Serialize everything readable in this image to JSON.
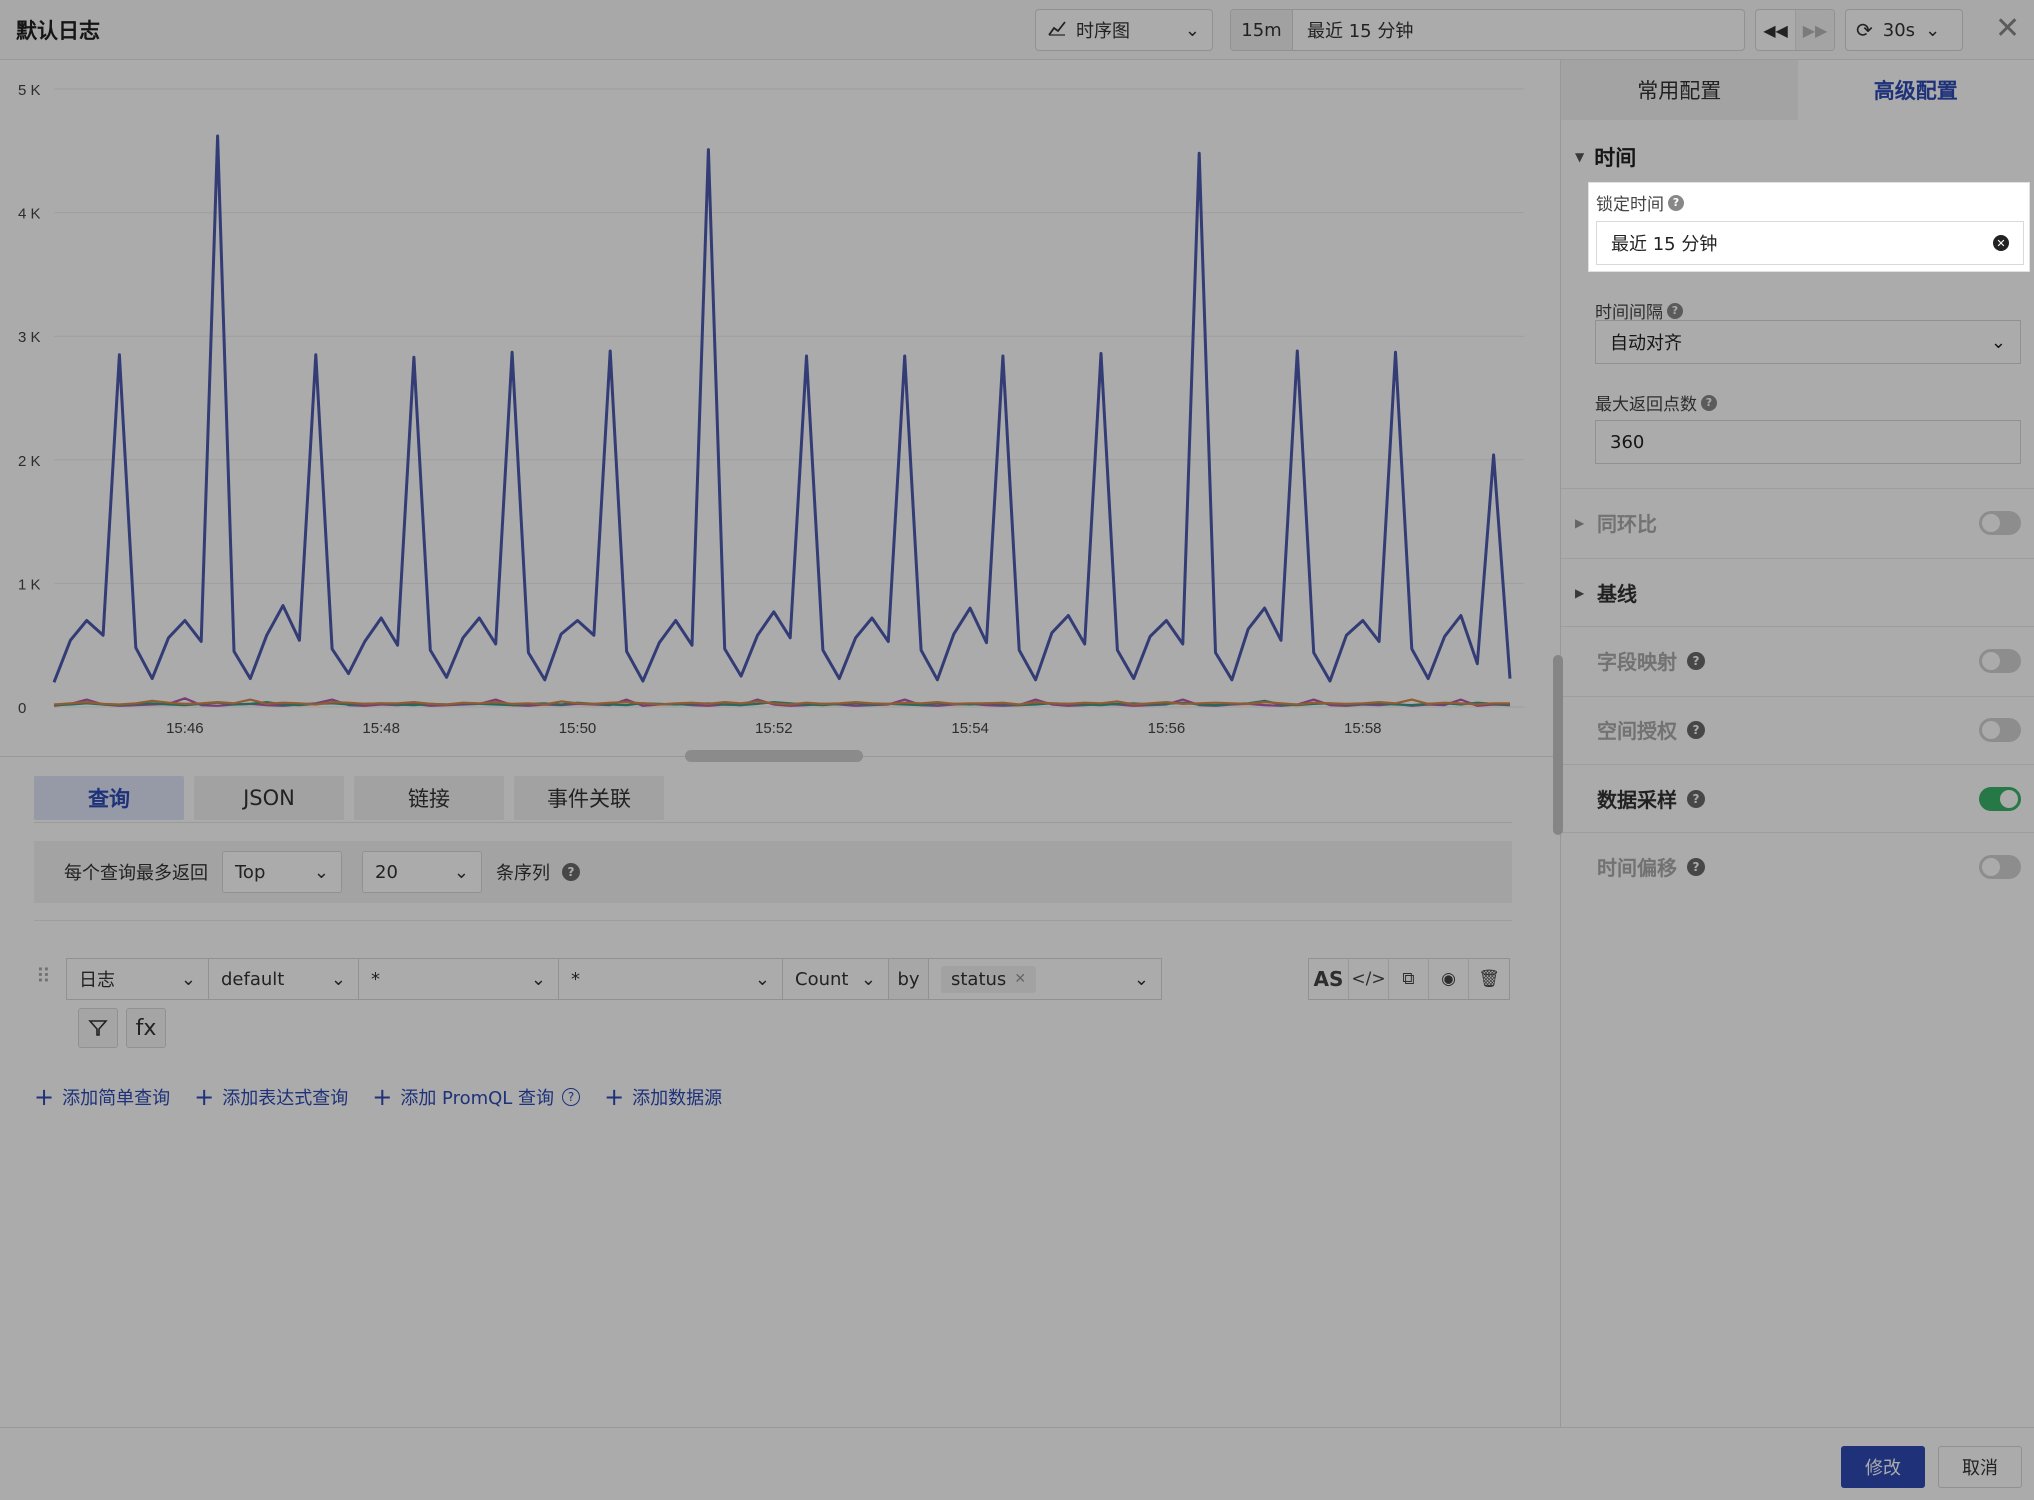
{
  "header": {
    "title": "默认日志",
    "viz_type": "时序图",
    "time_short": "15m",
    "time_long": "最近 15 分钟",
    "refresh_interval": "30s"
  },
  "chart_data": {
    "type": "line",
    "x": [
      "15:44:40",
      "15:44:50",
      "15:45:00",
      "15:45:10",
      "15:45:20",
      "15:45:30",
      "15:45:40",
      "15:45:50",
      "15:46:00",
      "15:46:10",
      "15:46:20",
      "15:46:30",
      "15:46:40",
      "15:46:50",
      "15:47:00",
      "15:47:10",
      "15:47:20",
      "15:47:30",
      "15:47:40",
      "15:47:50",
      "15:48:00",
      "15:48:10",
      "15:48:20",
      "15:48:30",
      "15:48:40",
      "15:48:50",
      "15:49:00",
      "15:49:10",
      "15:49:20",
      "15:49:30",
      "15:49:40",
      "15:49:50",
      "15:50:00",
      "15:50:10",
      "15:50:20",
      "15:50:30",
      "15:50:40",
      "15:50:50",
      "15:51:00",
      "15:51:10",
      "15:51:20",
      "15:51:30",
      "15:51:40",
      "15:51:50",
      "15:52:00",
      "15:52:10",
      "15:52:20",
      "15:52:30",
      "15:52:40",
      "15:52:50",
      "15:53:00",
      "15:53:10",
      "15:53:20",
      "15:53:30",
      "15:53:40",
      "15:53:50",
      "15:54:00",
      "15:54:10",
      "15:54:20",
      "15:54:30",
      "15:54:40",
      "15:54:50",
      "15:55:00",
      "15:55:10",
      "15:55:20",
      "15:55:30",
      "15:55:40",
      "15:55:50",
      "15:56:00",
      "15:56:10",
      "15:56:20",
      "15:56:30",
      "15:56:40",
      "15:56:50",
      "15:57:00",
      "15:57:10",
      "15:57:20",
      "15:57:30",
      "15:57:40",
      "15:57:50",
      "15:58:00",
      "15:58:10",
      "15:58:20",
      "15:58:30",
      "15:58:40",
      "15:58:50",
      "15:59:00",
      "15:59:10",
      "15:59:20",
      "15:59:30"
    ],
    "series": [
      {
        "color": "#4c5aaf",
        "values": [
          200,
          540,
          700,
          580,
          2850,
          480,
          230,
          560,
          700,
          530,
          4620,
          450,
          230,
          580,
          820,
          540,
          2850,
          470,
          270,
          530,
          720,
          500,
          2830,
          460,
          240,
          560,
          720,
          510,
          2870,
          440,
          220,
          590,
          700,
          580,
          2880,
          450,
          210,
          520,
          700,
          500,
          4510,
          470,
          250,
          580,
          770,
          560,
          2840,
          460,
          230,
          560,
          720,
          530,
          2840,
          460,
          220,
          590,
          800,
          520,
          2840,
          460,
          220,
          600,
          740,
          510,
          2860,
          460,
          230,
          570,
          700,
          510,
          4480,
          440,
          220,
          630,
          800,
          540,
          2880,
          440,
          210,
          580,
          700,
          530,
          2870,
          470,
          230,
          570,
          740,
          350,
          2040,
          230
        ]
      },
      {
        "color": "#d98a4a",
        "values": [
          20,
          30,
          40,
          25,
          20,
          30,
          50,
          35,
          25,
          30,
          40,
          30,
          60,
          25,
          35,
          30,
          20,
          40,
          35,
          25,
          30,
          30,
          40,
          25,
          20,
          35,
          30,
          40,
          25,
          30,
          20,
          45,
          30,
          25,
          35,
          40,
          30,
          20,
          30,
          35,
          25,
          40,
          30,
          45,
          30,
          20,
          35,
          25,
          30,
          40,
          30,
          25,
          35,
          30,
          40,
          25,
          30,
          30,
          35,
          20,
          40,
          30,
          25,
          35,
          30,
          45,
          20,
          30,
          40,
          25,
          30,
          35,
          30,
          25,
          40,
          30,
          20,
          35,
          30,
          25,
          30,
          40,
          30,
          60,
          25,
          35,
          30,
          20,
          30,
          30
        ]
      },
      {
        "color": "#3d9c8a",
        "values": [
          15,
          20,
          30,
          20,
          15,
          25,
          30,
          20,
          15,
          25,
          35,
          20,
          25,
          40,
          20,
          15,
          25,
          30,
          20,
          25,
          30,
          20,
          15,
          25,
          20,
          30,
          25,
          20,
          15,
          25,
          30,
          20,
          35,
          25,
          20,
          15,
          30,
          25,
          20,
          25,
          30,
          20,
          15,
          25,
          40,
          30,
          20,
          15,
          25,
          30,
          20,
          25,
          20,
          15,
          30,
          25,
          20,
          30,
          25,
          15,
          20,
          30,
          25,
          20,
          15,
          25,
          30,
          20,
          25,
          35,
          20,
          15,
          25,
          30,
          50,
          20,
          15,
          25,
          30,
          20,
          25,
          30,
          20,
          15,
          25,
          30,
          20,
          35,
          25,
          20
        ]
      },
      {
        "color": "#b55ab3",
        "values": [
          10,
          25,
          60,
          20,
          10,
          15,
          20,
          25,
          70,
          15,
          10,
          20,
          25,
          15,
          10,
          20,
          30,
          60,
          15,
          10,
          20,
          15,
          25,
          10,
          15,
          20,
          25,
          60,
          15,
          10,
          20,
          15,
          25,
          20,
          15,
          60,
          10,
          20,
          25,
          15,
          10,
          20,
          15,
          60,
          20,
          10,
          15,
          25,
          20,
          10,
          15,
          20,
          60,
          15,
          10,
          20,
          25,
          15,
          10,
          15,
          60,
          20,
          10,
          15,
          25,
          20,
          10,
          15,
          20,
          60,
          15,
          10,
          20,
          25,
          15,
          10,
          20,
          60,
          15,
          10,
          20,
          15,
          25,
          10,
          20,
          15,
          60,
          10,
          20,
          15
        ]
      }
    ],
    "x_ticks": [
      "15:46",
      "15:48",
      "15:50",
      "15:52",
      "15:54",
      "15:56",
      "15:58"
    ],
    "y_ticks": [
      "0",
      "1 K",
      "2 K",
      "3 K",
      "4 K",
      "5 K"
    ],
    "ylim": [
      0,
      5000
    ],
    "grid": true
  },
  "query_tabs": [
    "查询",
    "JSON",
    "链接",
    "事件关联"
  ],
  "limit_bar": {
    "label": "每个查询最多返回",
    "mode": "Top",
    "count": "20",
    "suffix": "条序列"
  },
  "query": {
    "source": "日志",
    "index": "default",
    "field1": "*",
    "field2": "*",
    "agg": "Count",
    "by": "by",
    "group_tag": "status",
    "as_label": "AS",
    "code_label": "</>",
    "fx_label": "fx"
  },
  "add_links": [
    "添加简单查询",
    "添加表达式查询",
    "添加 PromQL 查询",
    "添加数据源"
  ],
  "right_panel": {
    "tabs": [
      "常用配置",
      "高级配置"
    ],
    "time_section": "时间",
    "lock_time_label": "锁定时间",
    "lock_time_value": "最近 15 分钟",
    "interval_label": "时间间隔",
    "interval_value": "自动对齐",
    "max_points_label": "最大返回点数",
    "max_points_value": "360",
    "compare_label": "同环比",
    "baseline_label": "基线",
    "field_mapping_label": "字段映射",
    "space_auth_label": "空间授权",
    "sampling_label": "数据采样",
    "time_offset_label": "时间偏移"
  },
  "footer": {
    "confirm": "修改",
    "cancel": "取消"
  },
  "colors": {
    "accent": "#2d4ab5",
    "toggle_on": "#3bb36b"
  }
}
